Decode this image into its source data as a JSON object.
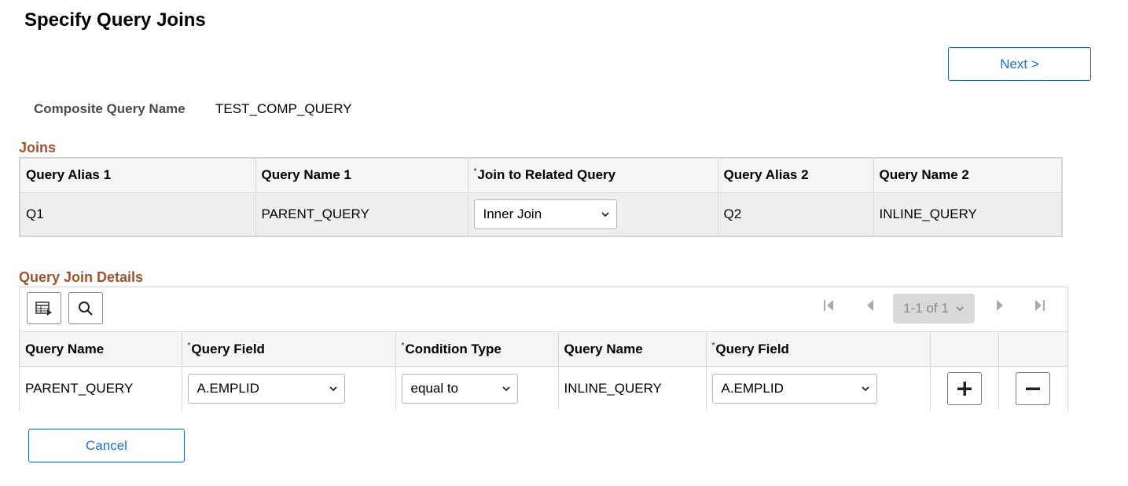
{
  "page": {
    "title": "Specify Query Joins"
  },
  "actions": {
    "next_label": "Next >",
    "cancel_label": "Cancel"
  },
  "composite": {
    "label": "Composite Query Name",
    "value": "TEST_COMP_QUERY"
  },
  "joins": {
    "title": "Joins",
    "required_marker": "*",
    "headers": [
      "Query Alias 1",
      "Query Name 1",
      "Join to Related Query",
      "Query Alias 2",
      "Query Name 2"
    ],
    "rows": [
      {
        "alias1": "Q1",
        "name1": "PARENT_QUERY",
        "join": "Inner Join",
        "alias2": "Q2",
        "name2": "INLINE_QUERY"
      }
    ]
  },
  "details": {
    "title": "Query Join Details",
    "pager": "1-1 of 1",
    "required_marker": "*",
    "headers": [
      "Query Name",
      "Query Field",
      "Condition Type",
      "Query Name",
      "Query Field"
    ],
    "rows": [
      {
        "name1": "PARENT_QUERY",
        "field1": "A.EMPLID",
        "condition": "equal to",
        "name2": "INLINE_QUERY",
        "field2": "A.EMPLID"
      }
    ]
  },
  "icons": [
    "grid-personalize-icon",
    "search-icon",
    "first-page-icon",
    "previous-page-icon",
    "next-page-icon",
    "last-page-icon",
    "add-row-icon",
    "delete-row-icon",
    "chevron-down-icon"
  ]
}
